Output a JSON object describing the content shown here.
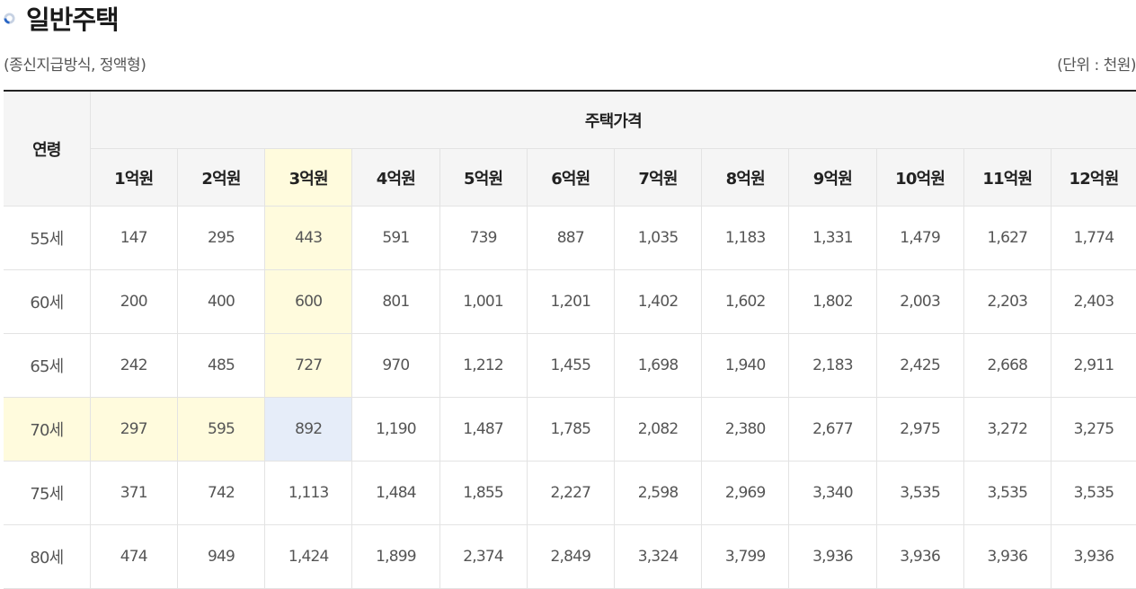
{
  "header": {
    "title": "일반주택",
    "subtitle": "(종신지급방식, 정액형)",
    "unit": "(단위 : 천원)"
  },
  "table": {
    "age_header": "연령",
    "price_header": "주택가격",
    "columns": [
      "1억원",
      "2억원",
      "3억원",
      "4억원",
      "5억원",
      "6억원",
      "7억원",
      "8억원",
      "9억원",
      "10억원",
      "11억원",
      "12억원"
    ],
    "rows": [
      {
        "age": "55세",
        "values": [
          "147",
          "295",
          "443",
          "591",
          "739",
          "887",
          "1,035",
          "1,183",
          "1,331",
          "1,479",
          "1,627",
          "1,774"
        ]
      },
      {
        "age": "60세",
        "values": [
          "200",
          "400",
          "600",
          "801",
          "1,001",
          "1,201",
          "1,402",
          "1,602",
          "1,802",
          "2,003",
          "2,203",
          "2,403"
        ]
      },
      {
        "age": "65세",
        "values": [
          "242",
          "485",
          "727",
          "970",
          "1,212",
          "1,455",
          "1,698",
          "1,940",
          "2,183",
          "2,425",
          "2,668",
          "2,911"
        ]
      },
      {
        "age": "70세",
        "values": [
          "297",
          "595",
          "892",
          "1,190",
          "1,487",
          "1,785",
          "2,082",
          "2,380",
          "2,677",
          "2,975",
          "3,272",
          "3,275"
        ]
      },
      {
        "age": "75세",
        "values": [
          "371",
          "742",
          "1,113",
          "1,484",
          "1,855",
          "2,227",
          "2,598",
          "2,969",
          "3,340",
          "3,535",
          "3,535",
          "3,535"
        ]
      },
      {
        "age": "80세",
        "values": [
          "474",
          "949",
          "1,424",
          "1,899",
          "2,374",
          "2,849",
          "3,324",
          "3,799",
          "3,936",
          "3,936",
          "3,936",
          "3,936"
        ]
      }
    ],
    "highlight": {
      "row": 3,
      "col": 2
    }
  },
  "colors": {
    "highlight_row_col": "#fffbdd",
    "highlight_cell": "#e6edf9",
    "header_bg": "#f5f5f5",
    "top_border": "#222222"
  },
  "icons": {
    "title_icon": "circle-arc-icon"
  }
}
